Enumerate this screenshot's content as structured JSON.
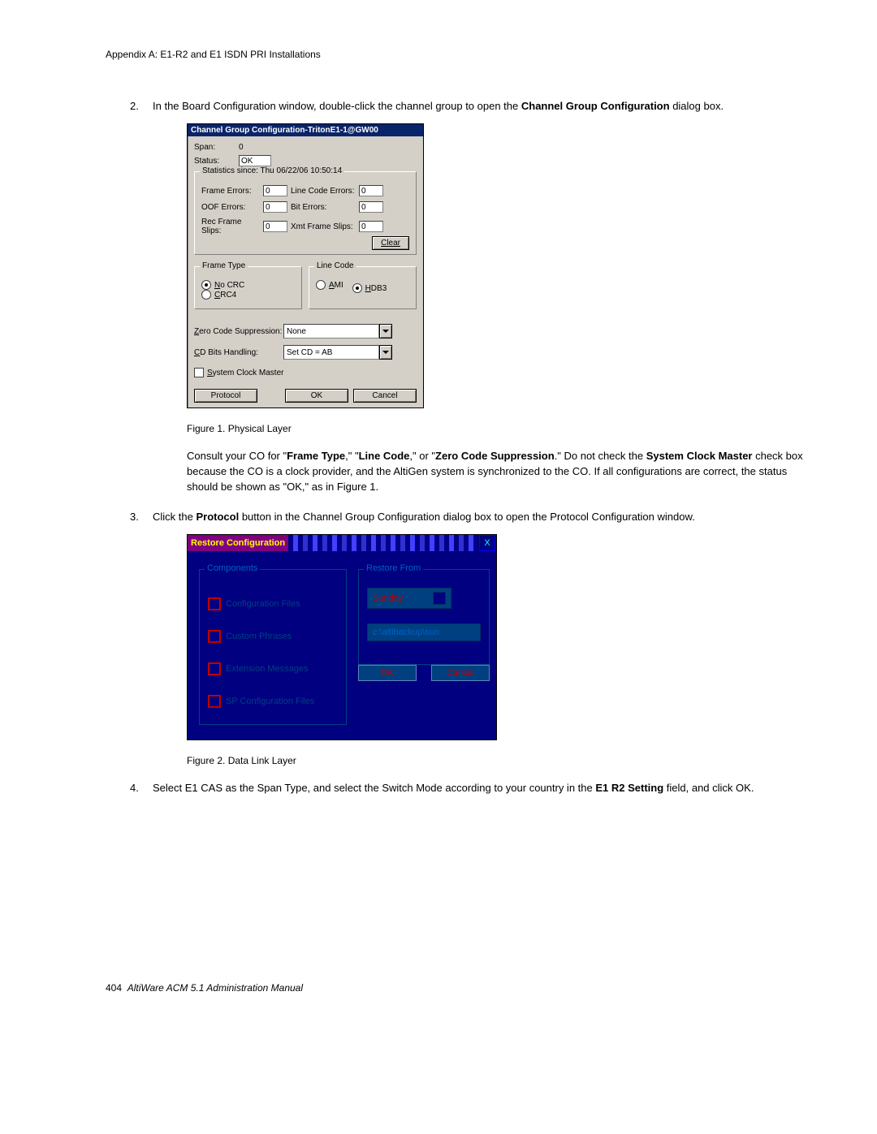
{
  "header": {
    "title": "Appendix A:  E1-R2 and E1 ISDN PRI Installations"
  },
  "footer": {
    "pagenum": "404",
    "manual": "AltiWare ACM 5.1 Administration Manual"
  },
  "steps": {
    "s2_num": "2.",
    "s2_a": "In the Board Configuration window, double-click the channel group to open the ",
    "s2_b": "Channel Group Configuration",
    "s2_c": " dialog box.",
    "s3_num": "3.",
    "s3_a": "Click the ",
    "s3_b": "Protocol",
    "s3_c": " button in the Channel Group Configuration dialog box to open the Protocol Configuration window.",
    "s4_num": "4.",
    "s4_a": "Select E1 CAS as the Span Type, and select the Switch Mode according to your country in the ",
    "s4_b": "E1 R2 Setting",
    "s4_c": " field, and click OK."
  },
  "figcaps": {
    "f1": "Figure 1.   Physical Layer",
    "f2": "Figure 2.   Data Link Layer"
  },
  "para1": {
    "a": "Consult your CO for \"",
    "b": "Frame Type",
    "c": ",\" \"",
    "d": "Line Code",
    "e": ",\" or \"",
    "f": "Zero Code Suppression",
    "g": ".\" Do not check the ",
    "h": "System Clock Master",
    "i": " check box because the CO is a clock provider, and the AltiGen system is synchronized to the CO. If all configurations are correct, the status should be shown as \"OK,\" as in Figure 1."
  },
  "dlg1": {
    "title": "Channel Group Configuration-TritonE1-1@GW00",
    "span_label": "Span:",
    "span_value": "0",
    "status_label": "Status:",
    "status_value": "OK",
    "stats_title": "Statistics since: Thu 06/22/06 10:50:14",
    "frame_errors_l": "Frame Errors:",
    "frame_errors_v": "0",
    "lce_l": "Line Code Errors:",
    "lce_v": "0",
    "oof_l": "OOF Errors:",
    "oof_v": "0",
    "bit_l": "Bit Errors:",
    "bit_v": "0",
    "rec_l": "Rec Frame Slips:",
    "rec_v": "0",
    "xmt_l": "Xmt Frame Slips:",
    "xmt_v": "0",
    "clear": "Clear",
    "frame_grp": "Frame Type",
    "nocrc": "No CRC",
    "nocrc_u": "N",
    "crc4": "CRC4",
    "crc4_u": "C",
    "line_grp": "Line Code",
    "ami": "AMI",
    "ami_u": "A",
    "hdb3": "HDB3",
    "hdb3_u": "H",
    "zcs_l": "Zero Code Suppression:",
    "zcs_l_u": "Z",
    "zcs_v": "None",
    "cd_l": "CD Bits Handling:",
    "cd_l_u": "C",
    "cd_v": "Set CD = AB",
    "scm": "System Clock Master",
    "scm_u": "S",
    "protocol": "Protocol",
    "ok": "OK",
    "cancel": "Cancel"
  },
  "dlg2": {
    "title": "Restore Configuration",
    "close": "X",
    "comp_grp": "Components",
    "c1": "Configuration Files",
    "c2": "Custom Phrases",
    "c3": "Extension Messages",
    "c4": "SP Configuration Files",
    "rf_grp": "Restore From",
    "day": "Sunday",
    "path": "c:\\altibackup\\sun",
    "ok": "OK",
    "cancel": "Cancel"
  }
}
